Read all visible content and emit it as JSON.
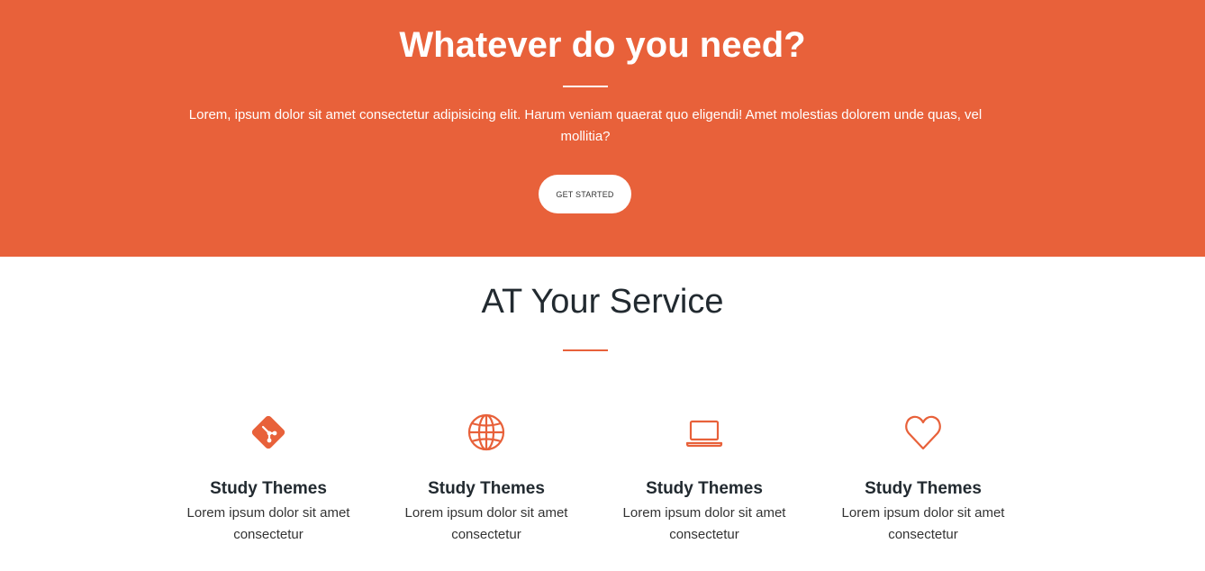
{
  "hero": {
    "title": "Whatever do you need?",
    "text": "Lorem, ipsum dolor sit amet consectetur adipisicing elit. Harum veniam quaerat quo eligendi! Amet molestias dolorem unde quas, vel mollitia?",
    "button_label": "GET STARTED",
    "background_color": "#e8613a"
  },
  "services": {
    "title": "AT Your Service",
    "accent_color": "#e8613a",
    "items": [
      {
        "icon": "git-icon",
        "title": "Study Themes",
        "text": "Lorem ipsum dolor sit amet consectetur"
      },
      {
        "icon": "globe-icon",
        "title": "Study Themes",
        "text": "Lorem ipsum dolor sit amet consectetur"
      },
      {
        "icon": "laptop-icon",
        "title": "Study Themes",
        "text": "Lorem ipsum dolor sit amet consectetur"
      },
      {
        "icon": "heart-icon",
        "title": "Study Themes",
        "text": "Lorem ipsum dolor sit amet consectetur"
      }
    ]
  }
}
